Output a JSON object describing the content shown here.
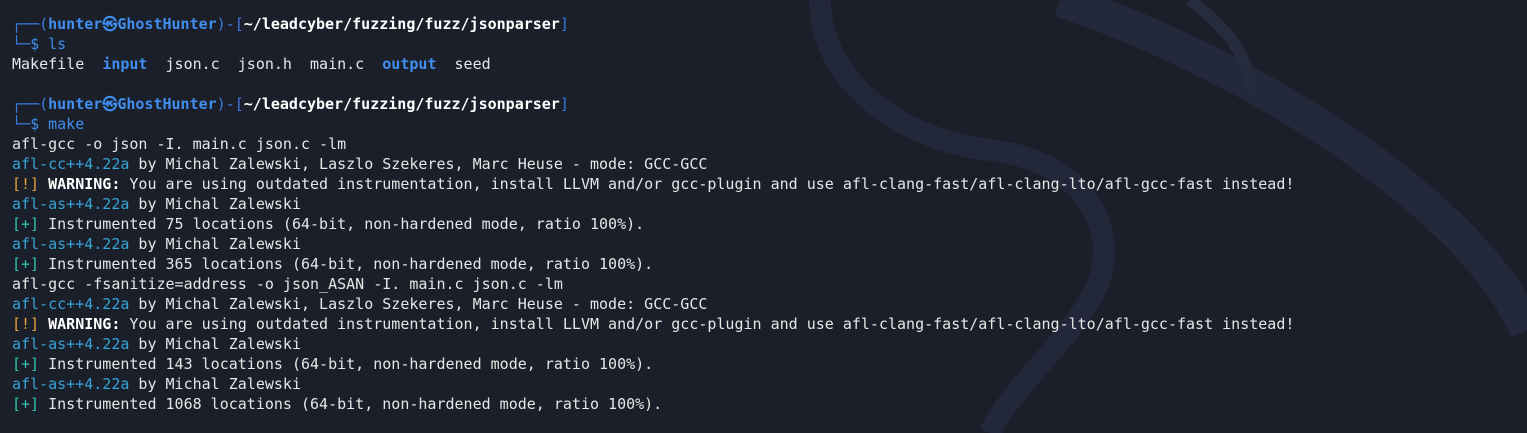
{
  "prompt": {
    "user": "hunter",
    "host": "GhostHunter",
    "cwd": "~/leadcyber/fuzzing/fuzz/jsonparser",
    "symbol": "㉿",
    "dollar": "$"
  },
  "commands": [
    "ls",
    "make"
  ],
  "ls_output": [
    {
      "name": "Makefile",
      "type": "file"
    },
    {
      "name": "input",
      "type": "dir"
    },
    {
      "name": "json.c",
      "type": "file"
    },
    {
      "name": "json.h",
      "type": "file"
    },
    {
      "name": "main.c",
      "type": "file"
    },
    {
      "name": "output",
      "type": "dir"
    },
    {
      "name": "seed",
      "type": "file"
    }
  ],
  "make_output": {
    "gcc1": "afl-gcc -o json -I. main.c json.c -lm",
    "cc_tool": "afl-cc++4.22a",
    "cc_authors": " by Michal Zalewski, Laszlo Szekeres, Marc Heuse - mode: GCC-GCC",
    "warn_prefix": "[!]",
    "warn_label": "WARNING:",
    "warn_text": " You are using outdated instrumentation, install LLVM and/or gcc-plugin and use afl-clang-fast/afl-clang-lto/afl-gcc-fast instead!",
    "as_tool": "afl-as++4.22a",
    "as_author": " by Michal Zalewski",
    "plus_prefix": "[+]",
    "inst1": " Instrumented 75 locations (64-bit, non-hardened mode, ratio 100%).",
    "inst2": " Instrumented 365 locations (64-bit, non-hardened mode, ratio 100%).",
    "gcc2": "afl-gcc -fsanitize=address -o json_ASAN -I. main.c json.c -lm",
    "inst3": " Instrumented 143 locations (64-bit, non-hardened mode, ratio 100%).",
    "inst4": " Instrumented 1068 locations (64-bit, non-hardened mode, ratio 100%)."
  },
  "colors": {
    "background": "#1b1f29",
    "prompt_blue": "#3f8ef0",
    "tool_blue": "#36a3d9",
    "warn_orange": "#e8a33a",
    "ok_teal": "#2fc6b0"
  }
}
